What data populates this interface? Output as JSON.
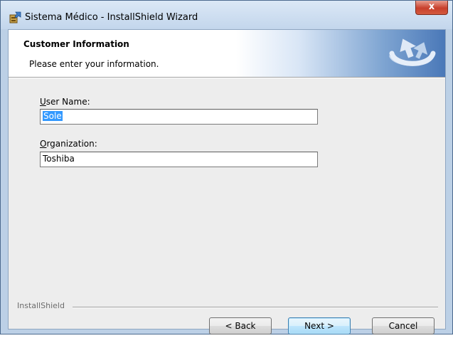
{
  "window": {
    "title": "Sistema Médico - InstallShield Wizard",
    "close_label": "x"
  },
  "header": {
    "title": "Customer Information",
    "subtitle": "Please enter your information."
  },
  "form": {
    "user_name": {
      "label_accel": "U",
      "label_rest": "ser Name:",
      "value": "Sole",
      "selected": true
    },
    "organization": {
      "label_accel": "O",
      "label_rest": "rganization:",
      "value": "Toshiba"
    }
  },
  "footer": {
    "brand": "InstallShield",
    "back_label": "< Back",
    "next_label": "Next >",
    "cancel_label": "Cancel"
  },
  "colors": {
    "accent": "#3399ff",
    "banner": "#4a78b8",
    "close_red": "#c8402c"
  },
  "icons": {
    "app": "installer-app-icon",
    "banner": "installshield-logo",
    "close": "close-icon"
  }
}
